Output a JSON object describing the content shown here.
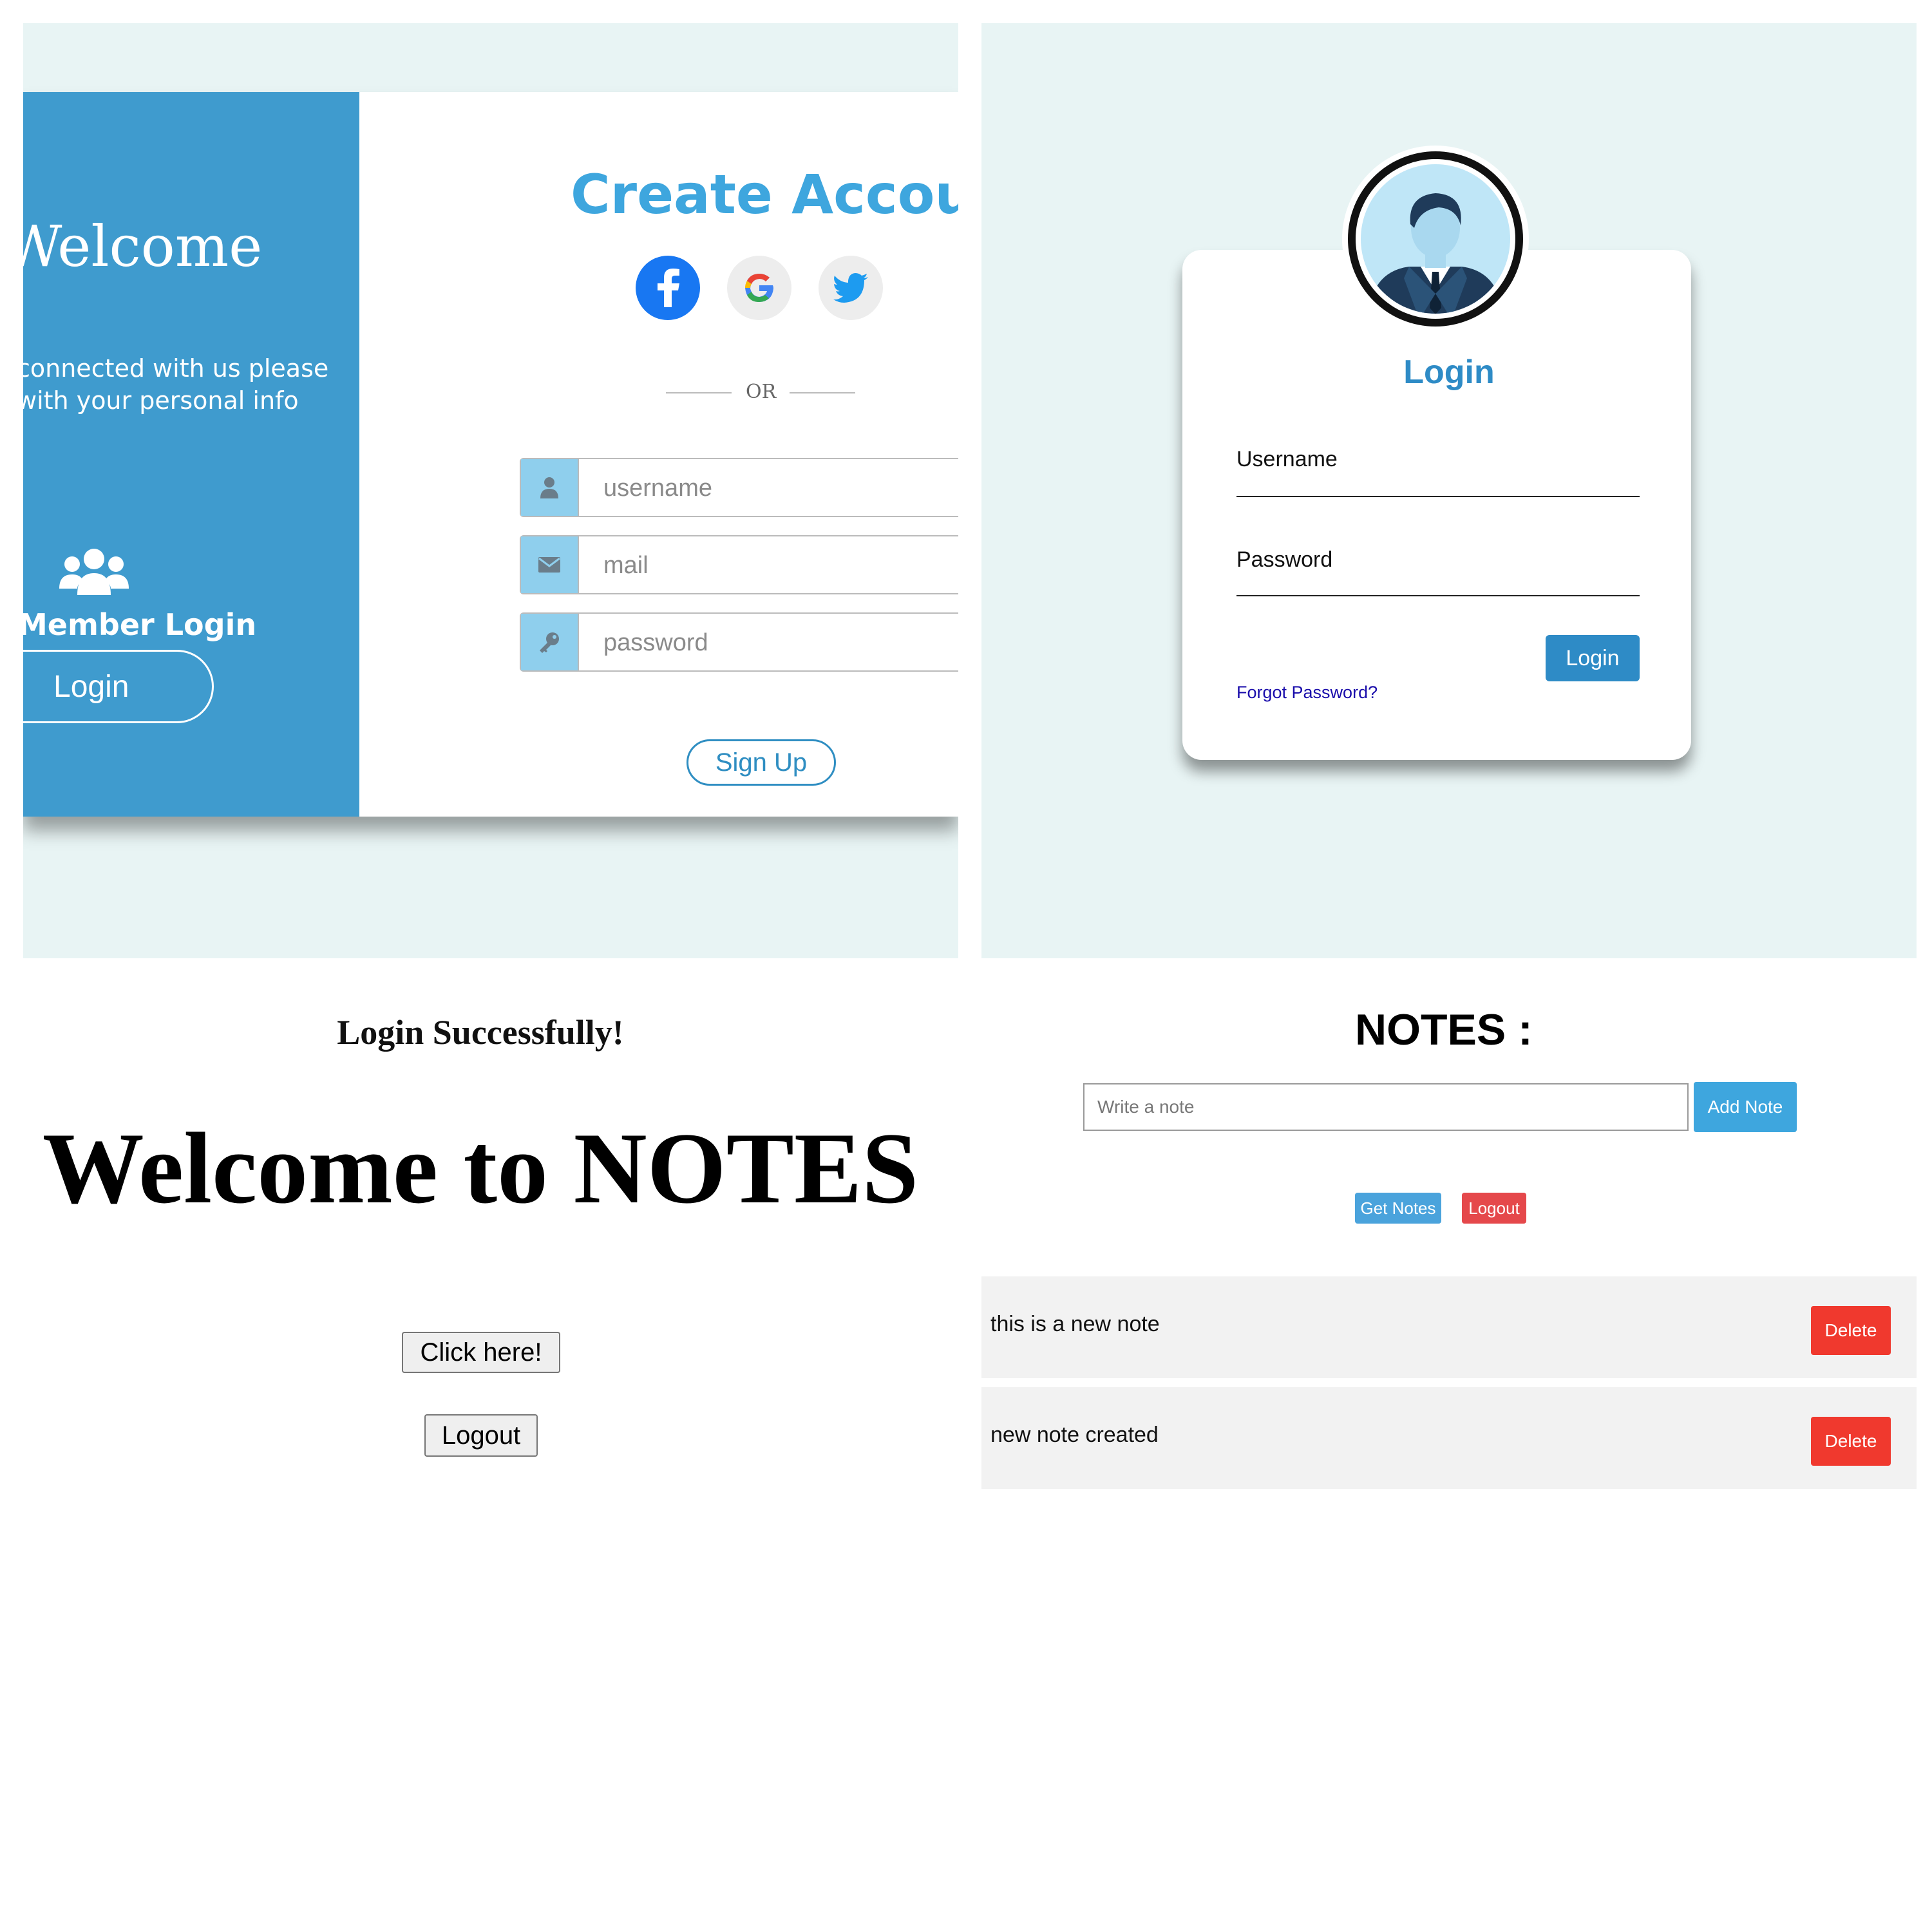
{
  "create_account": {
    "welcome_title": "Welcome",
    "subtitle_lines": [
      "connected with us please",
      "with your personal info"
    ],
    "member_login": "Member Login",
    "login_button": "Login",
    "title": "Create Account",
    "or_text": "OR",
    "fields": [
      {
        "placeholder": "username",
        "icon": "user-icon"
      },
      {
        "placeholder": "mail",
        "icon": "envelope-icon"
      },
      {
        "placeholder": "password",
        "icon": "key-icon"
      }
    ],
    "signup_button": "Sign Up",
    "colors": {
      "left_panel": "#3f9bce",
      "title": "#3ea6de",
      "icon_box": "#8fcfed",
      "background": "#e8f4f4"
    }
  },
  "login_card": {
    "title": "Login",
    "username_label": "Username",
    "password_label": "Password",
    "login_button": "Login",
    "forgot_link": "Forgot Password?",
    "colors": {
      "accent": "#2e8bc6"
    }
  },
  "welcome_page": {
    "success_text": "Login Successfully!",
    "heading": "Welcome to NOTES",
    "click_button": "Click here!",
    "logout_button": "Logout"
  },
  "notes_page": {
    "title": "NOTES :",
    "input_placeholder": "Write a note",
    "add_button": "Add Note",
    "get_notes_button": "Get Notes",
    "logout_button": "Logout",
    "delete_label": "Delete",
    "notes": [
      {
        "text": "this is a new note"
      },
      {
        "text": "new note created"
      }
    ],
    "colors": {
      "primary": "#3ea6de",
      "danger": "#f0392e"
    }
  }
}
